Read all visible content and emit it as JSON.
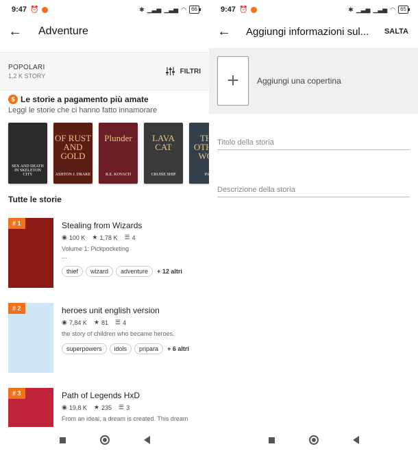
{
  "left": {
    "status": {
      "time": "9:47",
      "battery": "66"
    },
    "header": {
      "title": "Adventure"
    },
    "filter": {
      "sort_label": "POPOLARI",
      "count": "1,2 K STORY",
      "filter_label": "FILTRI"
    },
    "paid": {
      "title": "Le storie a pagamento più amate",
      "subtitle": "Leggi le storie che ci hanno fatto innamorare"
    },
    "covers": [
      {
        "big": "",
        "text": "SEX AND DEATH IN SKELETON CITY",
        "color": "#2b2b2b"
      },
      {
        "big": "OF RUST AND GOLD",
        "text": "ASHTON J. DRAKE",
        "color": "#5a1d12"
      },
      {
        "big": "Plunder",
        "text": "R.E. KOVACH",
        "color": "#6b1e25"
      },
      {
        "big": "LAVA CAT",
        "text": "CRUISE SHIP",
        "color": "#3a3a3a"
      },
      {
        "big": "THE OTHER WOR",
        "text": "PAU",
        "color": "#33404a"
      }
    ],
    "section_title": "Tutte le storie",
    "stories": [
      {
        "rank": "# 1",
        "name": "Stealing from Wizards",
        "reads": "100 K",
        "votes": "1,78 K",
        "parts": "4",
        "desc": "Volume 1: Pickpocketing",
        "desc2": "...",
        "tags": [
          "thief",
          "wizard",
          "adventure"
        ],
        "more": "+ 12 altri",
        "thumb_color": "#8e1a15"
      },
      {
        "rank": "# 2",
        "name": "heroes unit english version",
        "reads": "7,84 K",
        "votes": "81",
        "parts": "4",
        "desc": "the story of children who became heroes.",
        "desc2": "",
        "tags": [
          "superpowers",
          "idols",
          "pripara"
        ],
        "more": "+ 6 altri",
        "thumb_color": "#cfe6f5"
      },
      {
        "rank": "# 3",
        "name": "Path of Legends HxD",
        "reads": "19,8 K",
        "votes": "235",
        "parts": "3",
        "desc": "From an ideal, a dream is created. This dream",
        "desc2": "",
        "tags": [],
        "more": "",
        "thumb_color": "#c0243a"
      }
    ]
  },
  "right": {
    "status": {
      "time": "9:47",
      "battery": "65"
    },
    "header": {
      "title": "Aggiungi informazioni sul...",
      "skip": "SALTA"
    },
    "add_cover": "Aggiungi una copertina",
    "title_placeholder": "Titolo della storia",
    "desc_placeholder": "Descrizione della storia"
  },
  "colors": {
    "accent": "#f2721c"
  }
}
